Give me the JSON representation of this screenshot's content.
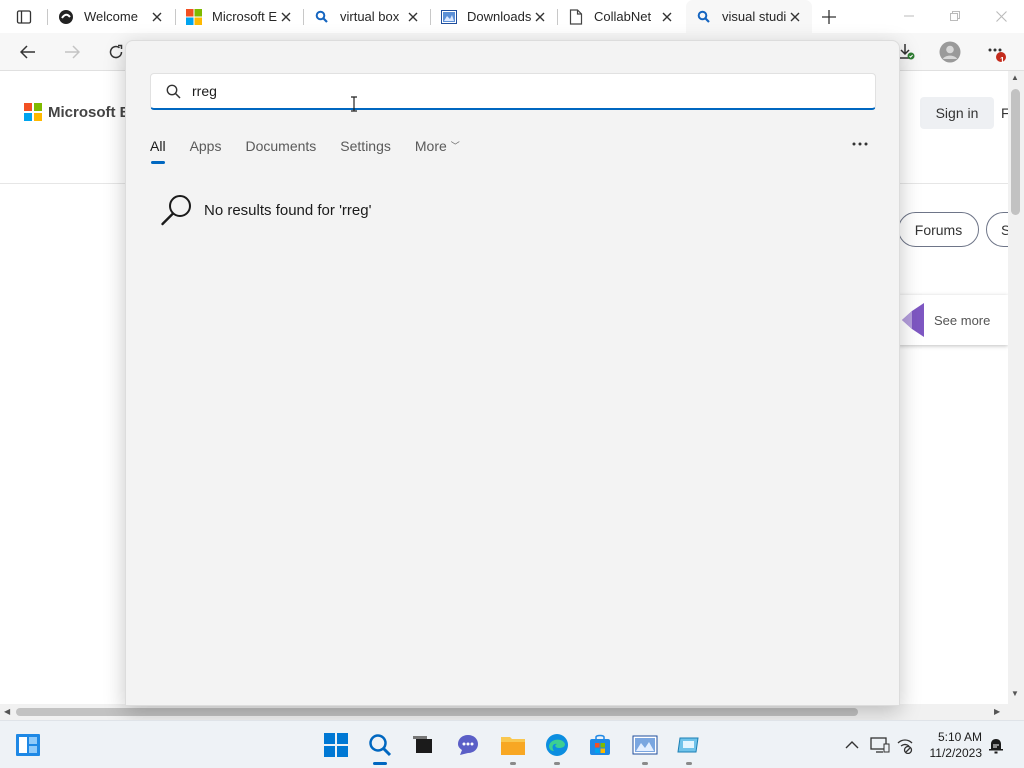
{
  "browser": {
    "tabs": [
      {
        "title": "Welcome",
        "icon": "edge-dev-icon"
      },
      {
        "title": "Microsoft E",
        "icon": "microsoft-logo-icon"
      },
      {
        "title": "virtual box",
        "icon": "search-icon"
      },
      {
        "title": "Downloads",
        "icon": "downloads-page-icon"
      },
      {
        "title": "CollabNet",
        "icon": "document-icon"
      },
      {
        "title": "visual studi",
        "icon": "search-icon"
      }
    ],
    "notification_badge": "1"
  },
  "page": {
    "logo_text": "Microsoft Bi",
    "signin_label": "Sign in",
    "signin_tail": "F",
    "pills": [
      "Forums",
      "S"
    ],
    "see_more": "See more"
  },
  "search": {
    "query": "rreg",
    "tabs": [
      "All",
      "Apps",
      "Documents",
      "Settings",
      "More"
    ],
    "active_tab": "All",
    "no_results": "No results found for 'rreg'"
  },
  "taskbar": {
    "time": "5:10 AM",
    "date": "11/2/2023"
  },
  "colors": {
    "accent": "#0067c0",
    "flyout_bg": "#f3f3f3",
    "taskbar_bg": "#eef2f6"
  }
}
